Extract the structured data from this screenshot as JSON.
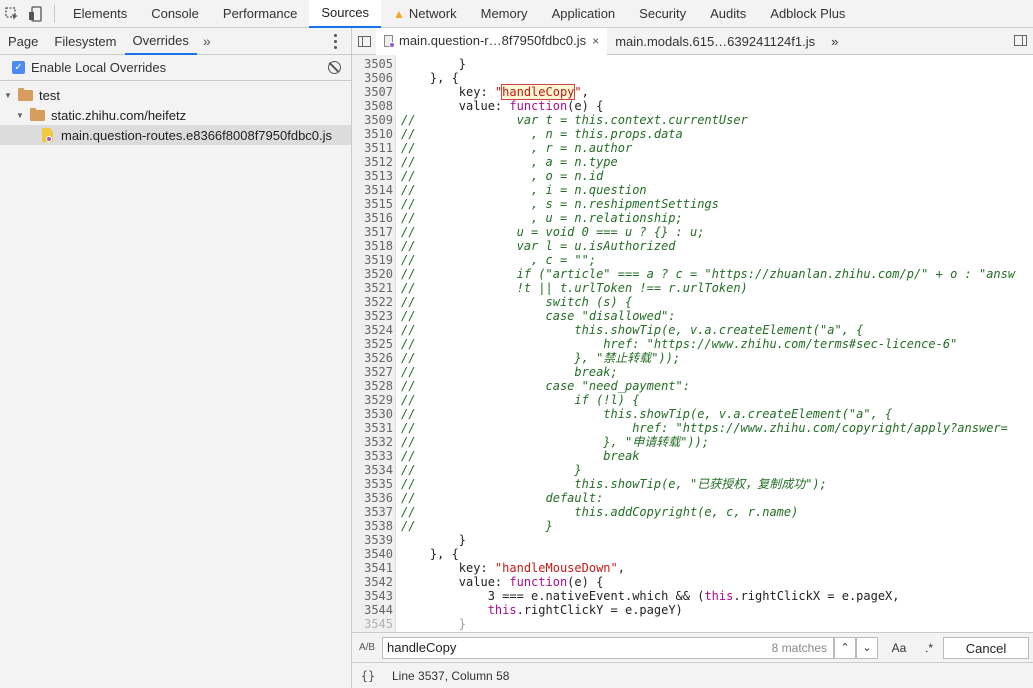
{
  "toolbar": {
    "tabs": [
      "Elements",
      "Console",
      "Performance",
      "Sources",
      "Network",
      "Memory",
      "Application",
      "Security",
      "Audits",
      "Adblock Plus"
    ],
    "active_tab": "Sources"
  },
  "left_panel": {
    "subtabs": [
      "Page",
      "Filesystem",
      "Overrides"
    ],
    "more": "»",
    "enable_overrides_label": "Enable Local Overrides",
    "tree": {
      "root": "test",
      "folder": "static.zhihu.com/heifetz",
      "file": "main.question-routes.e8366f8008f7950fdbc0.js"
    }
  },
  "editor": {
    "tabs": [
      {
        "label": "main.question-r…8f7950fdbc0.js",
        "close": "×"
      },
      {
        "label": "main.modals.615…639241124f1.js"
      }
    ],
    "more": "»",
    "lines": [
      {
        "n": "3505",
        "text": "        }"
      },
      {
        "n": "3506",
        "text": "    }, {"
      },
      {
        "n": "3507",
        "text": "        key: \"handleCopy\","
      },
      {
        "n": "3508",
        "text": "        value: function(e) {"
      },
      {
        "n": "3509",
        "text": "//              var t = this.context.currentUser"
      },
      {
        "n": "3510",
        "text": "//                , n = this.props.data"
      },
      {
        "n": "3511",
        "text": "//                , r = n.author"
      },
      {
        "n": "3512",
        "text": "//                , a = n.type"
      },
      {
        "n": "3513",
        "text": "//                , o = n.id"
      },
      {
        "n": "3514",
        "text": "//                , i = n.question"
      },
      {
        "n": "3515",
        "text": "//                , s = n.reshipmentSettings"
      },
      {
        "n": "3516",
        "text": "//                , u = n.relationship;"
      },
      {
        "n": "3517",
        "text": "//              u = void 0 === u ? {} : u;"
      },
      {
        "n": "3518",
        "text": "//              var l = u.isAuthorized"
      },
      {
        "n": "3519",
        "text": "//                , c = \"\";"
      },
      {
        "n": "3520",
        "text": "//              if (\"article\" === a ? c = \"https://zhuanlan.zhihu.com/p/\" + o : \"answ"
      },
      {
        "n": "3521",
        "text": "//              !t || t.urlToken !== r.urlToken)"
      },
      {
        "n": "3522",
        "text": "//                  switch (s) {"
      },
      {
        "n": "3523",
        "text": "//                  case \"disallowed\":"
      },
      {
        "n": "3524",
        "text": "//                      this.showTip(e, v.a.createElement(\"a\", {"
      },
      {
        "n": "3525",
        "text": "//                          href: \"https://www.zhihu.com/terms#sec-licence-6\""
      },
      {
        "n": "3526",
        "text": "//                      }, \"禁止转载\"));"
      },
      {
        "n": "3527",
        "text": "//                      break;"
      },
      {
        "n": "3528",
        "text": "//                  case \"need_payment\":"
      },
      {
        "n": "3529",
        "text": "//                      if (!l) {"
      },
      {
        "n": "3530",
        "text": "//                          this.showTip(e, v.a.createElement(\"a\", {"
      },
      {
        "n": "3531",
        "text": "//                              href: \"https://www.zhihu.com/copyright/apply?answer="
      },
      {
        "n": "3532",
        "text": "//                          }, \"申请转载\"));"
      },
      {
        "n": "3533",
        "text": "//                          break"
      },
      {
        "n": "3534",
        "text": "//                      }"
      },
      {
        "n": "3535",
        "text": "//                      this.showTip(e, \"已获授权，复制成功\");"
      },
      {
        "n": "3536",
        "text": "//                  default:"
      },
      {
        "n": "3537",
        "text": "//                      this.addCopyright(e, c, r.name)"
      },
      {
        "n": "3538",
        "text": "//                  }"
      },
      {
        "n": "3539",
        "text": "        }"
      },
      {
        "n": "3540",
        "text": "    }, {"
      },
      {
        "n": "3541",
        "text": "        key: \"handleMouseDown\","
      },
      {
        "n": "3542",
        "text": "        value: function(e) {"
      },
      {
        "n": "3543",
        "text": "            3 === e.nativeEvent.which && (this.rightClickX = e.pageX,"
      },
      {
        "n": "3544",
        "text": "            this.rightClickY = e.pageY)"
      },
      {
        "n": "3545",
        "text": "        }"
      }
    ]
  },
  "search": {
    "icon": "A/B",
    "query": "handleCopy",
    "matches": "8 matches",
    "up": "⌃",
    "down": "⌄",
    "case": "Aa",
    "regex": ".*",
    "cancel": "Cancel"
  },
  "status": {
    "braces": "{}",
    "position": "Line 3537, Column 58"
  }
}
